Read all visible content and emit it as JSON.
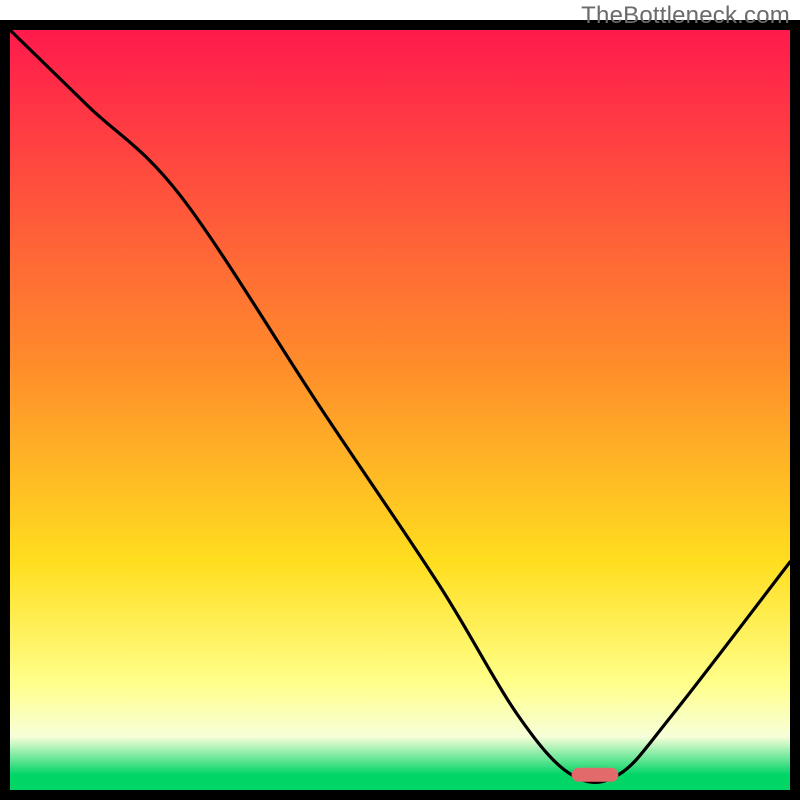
{
  "watermark": "TheBottleneck.com",
  "colors": {
    "top": "#ff1a4d",
    "mid_upper": "#ff8f2a",
    "mid": "#ffde1f",
    "lower": "#ffff8a",
    "pale": "#f7ffd9",
    "green": "#00d566",
    "curve": "#000000",
    "marker": "#e26a6a",
    "border": "#000000"
  },
  "chart_data": {
    "type": "line",
    "title": "",
    "xlabel": "",
    "ylabel": "",
    "xlim": [
      0,
      100
    ],
    "ylim": [
      0,
      100
    ],
    "series": [
      {
        "name": "bottleneck-curve",
        "x": [
          0,
          10,
          22,
          40,
          55,
          65,
          72,
          78,
          85,
          100
        ],
        "y": [
          100,
          90,
          78,
          50,
          27,
          10,
          2,
          2,
          10,
          30
        ]
      }
    ],
    "marker": {
      "name": "sweet-spot",
      "x_start": 72,
      "x_end": 78,
      "y": 2
    },
    "gradient_bands_pct_from_top": [
      {
        "stop": 0,
        "color_key": "top"
      },
      {
        "stop": 45,
        "color_key": "mid_upper"
      },
      {
        "stop": 70,
        "color_key": "mid"
      },
      {
        "stop": 86,
        "color_key": "lower"
      },
      {
        "stop": 93,
        "color_key": "pale"
      },
      {
        "stop": 98,
        "color_key": "green"
      },
      {
        "stop": 100,
        "color_key": "green"
      }
    ]
  }
}
